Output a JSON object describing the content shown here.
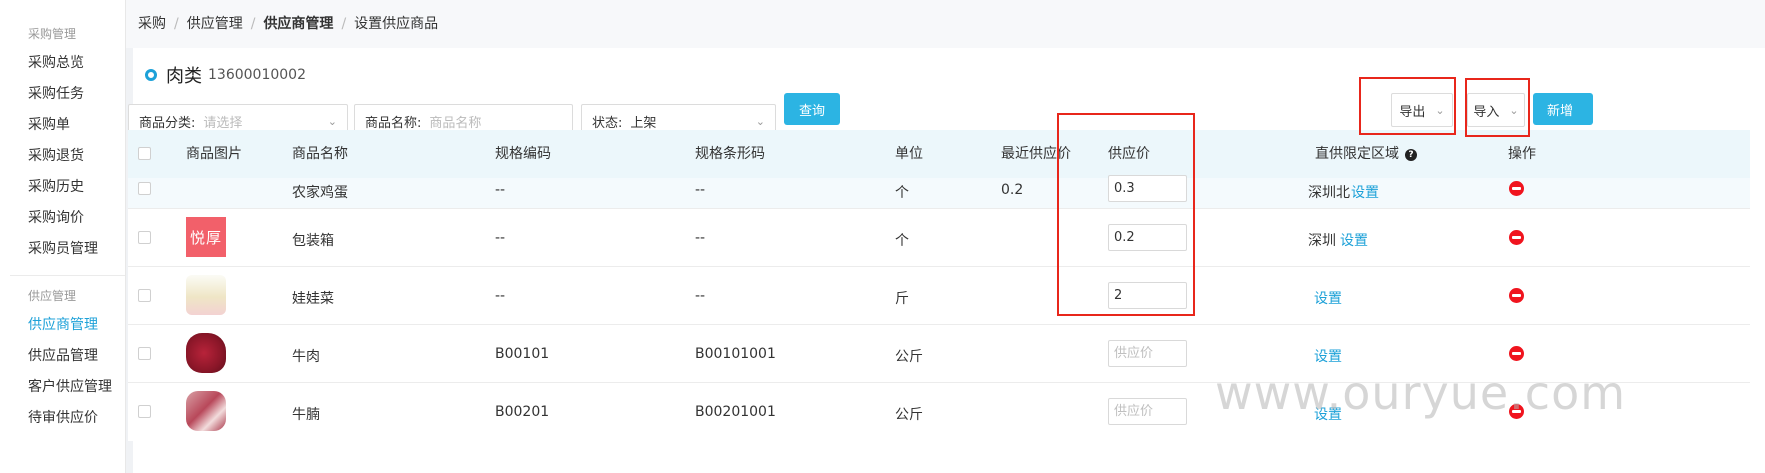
{
  "sidebar": {
    "groups": [
      {
        "title": "采购管理",
        "items": [
          "采购总览",
          "采购任务",
          "采购单",
          "采购退货",
          "采购历史",
          "采购询价",
          "采购员管理"
        ]
      },
      {
        "title": "供应管理",
        "items": [
          "供应商管理",
          "供应品管理",
          "客户供应管理",
          "待审供应价"
        ]
      }
    ],
    "active_item": "供应商管理"
  },
  "breadcrumb": [
    "采购",
    "供应管理",
    "供应商管理",
    "设置供应商品"
  ],
  "header": {
    "title": "肉类",
    "phone": "13600010002"
  },
  "filters": {
    "category_label": "商品分类:",
    "category_placeholder": "请选择",
    "name_label": "商品名称:",
    "name_placeholder": "商品名称",
    "status_label": "状态:",
    "status_value": "上架"
  },
  "buttons": {
    "query": "查询",
    "export": "导出",
    "import": "导入",
    "new": "新增"
  },
  "table": {
    "columns": [
      "商品图片",
      "商品名称",
      "规格编码",
      "规格条形码",
      "单位",
      "最近供应价",
      "供应价",
      "直供限定区域",
      "操作"
    ],
    "price_placeholder": "供应价",
    "set_link": "设置",
    "rows": [
      {
        "image": "",
        "name": "农家鸡蛋",
        "spec_code": "--",
        "barcode": "--",
        "unit": "个",
        "recent_price": "0.2",
        "price": "0.3",
        "region": "深圳北"
      },
      {
        "image": "悦厚",
        "name": "包装箱",
        "spec_code": "--",
        "barcode": "--",
        "unit": "个",
        "recent_price": "",
        "price": "0.2",
        "region": "深圳"
      },
      {
        "image": "cabbage",
        "name": "娃娃菜",
        "spec_code": "--",
        "barcode": "--",
        "unit": "斤",
        "recent_price": "",
        "price": "2",
        "region": ""
      },
      {
        "image": "beef",
        "name": "牛肉",
        "spec_code": "B00101",
        "barcode": "B00101001",
        "unit": "公斤",
        "recent_price": "",
        "price": "",
        "region": ""
      },
      {
        "image": "brisket",
        "name": "牛腩",
        "spec_code": "B00201",
        "barcode": "B00201001",
        "unit": "公斤",
        "recent_price": "",
        "price": "",
        "region": ""
      }
    ]
  },
  "watermark": "www.ouryue.com",
  "colors": {
    "accent": "#1da1d8",
    "primary_button": "#2cb4e3",
    "highlight_box": "#e8261b",
    "delete_icon": "#f0141e"
  }
}
